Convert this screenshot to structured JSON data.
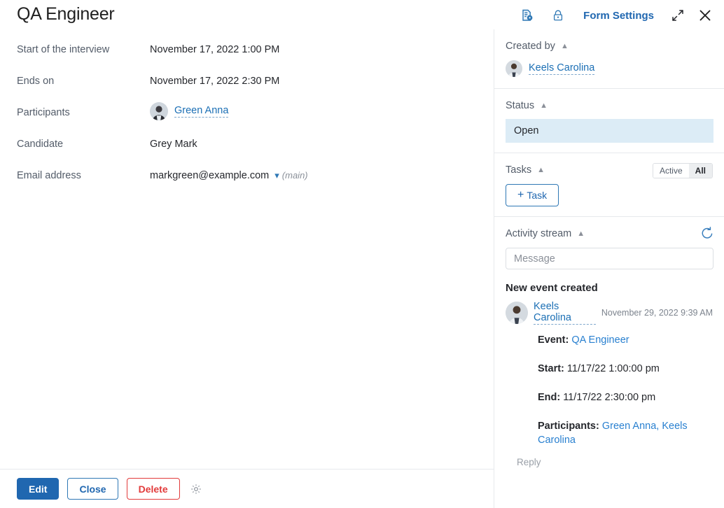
{
  "header": {
    "title": "QA Engineer",
    "form_settings_label": "Form Settings",
    "icons": {
      "document_settings": "document-settings-icon",
      "lock": "lock-icon",
      "expand": "expand-icon",
      "close": "close-icon"
    }
  },
  "details": {
    "fields": [
      {
        "label": "Start of the interview",
        "value": "November 17, 2022 1:00 PM"
      },
      {
        "label": "Ends on",
        "value": "November 17, 2022 2:30 PM"
      },
      {
        "label": "Participants",
        "value": "Green Anna"
      },
      {
        "label": "Candidate",
        "value": "Grey Mark"
      },
      {
        "label": "Email address",
        "value": "markgreen@example.com",
        "suffix": "(main)"
      }
    ]
  },
  "footer": {
    "edit_label": "Edit",
    "close_label": "Close",
    "delete_label": "Delete",
    "gear_icon": "gear-icon"
  },
  "side_panel": {
    "created_by": {
      "title": "Created by",
      "person": "Keels Carolina"
    },
    "status": {
      "title": "Status",
      "value": "Open",
      "highlight_color": "#dcecf6"
    },
    "tasks": {
      "title": "Tasks",
      "toggle": {
        "active_label": "Active",
        "all_label": "All",
        "selected": "All"
      },
      "add_label": "Task",
      "add_plus": "+"
    },
    "activity": {
      "title": "Activity stream",
      "refresh_icon": "refresh-icon",
      "message_placeholder": "Message",
      "event": {
        "title": "New event created",
        "author": "Keels Carolina",
        "timestamp": "November 29, 2022 9:39 AM",
        "lines": [
          {
            "key": "Event:",
            "value": "QA Engineer",
            "link": true
          },
          {
            "key": "Start:",
            "value": "11/17/22 1:00:00 pm",
            "link": false
          },
          {
            "key": "End:",
            "value": "11/17/22 2:30:00 pm",
            "link": false
          }
        ],
        "participants_key": "Participants:",
        "participants": [
          "Green Anna,",
          "Keels Carolina"
        ],
        "reply_label": "Reply"
      }
    }
  },
  "colors": {
    "accent_blue": "#2067b0",
    "link_blue": "#1b6fb5",
    "danger_red": "#e23b3b",
    "status_bg": "#dcecf6"
  }
}
